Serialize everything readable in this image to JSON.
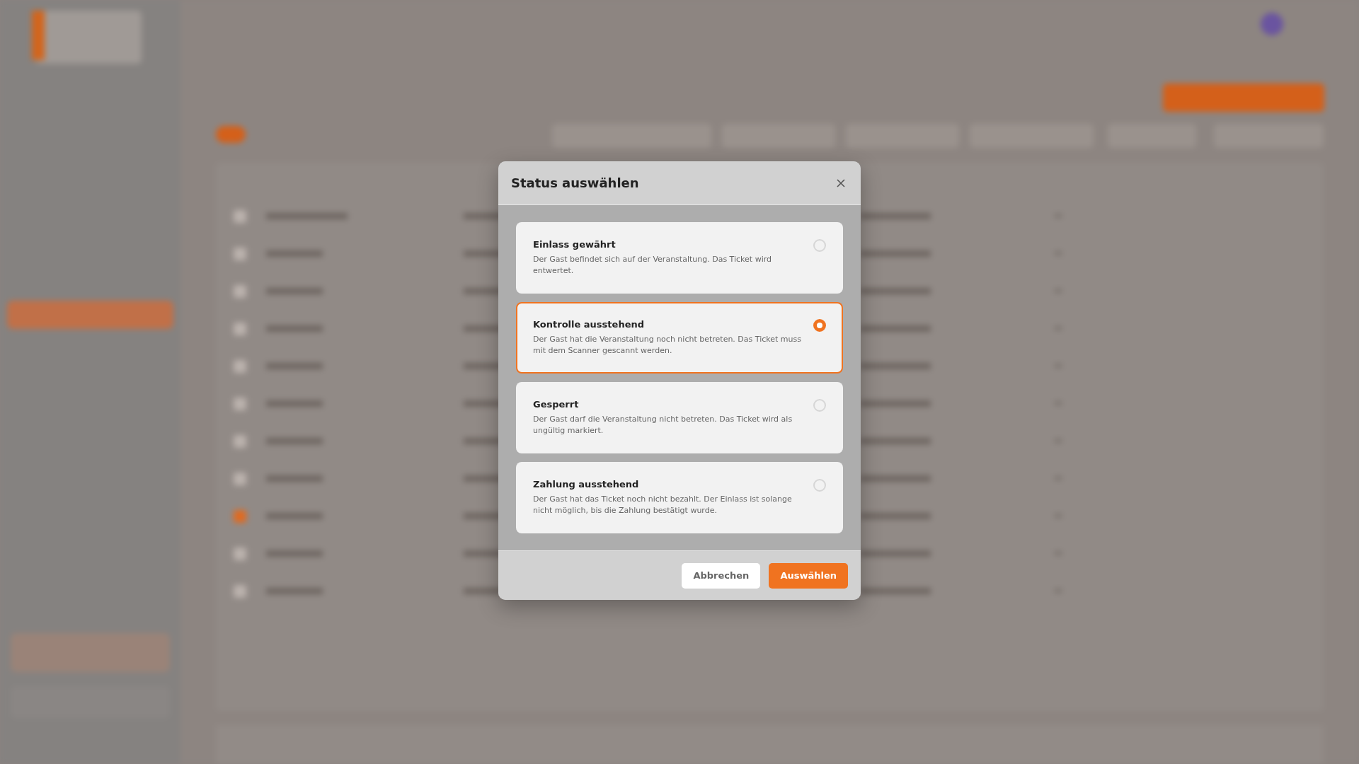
{
  "dialog": {
    "title": "Status auswählen",
    "options": [
      {
        "label": "Einlass gewährt",
        "description": "Der Gast befindet sich auf der Veranstaltung. Das Ticket wird entwertet.",
        "selected": false
      },
      {
        "label": "Kontrolle ausstehend",
        "description": "Der Gast hat die Veranstaltung noch nicht betreten. Das Ticket muss mit dem Scanner gescannt werden.",
        "selected": true
      },
      {
        "label": "Gesperrt",
        "description": "Der Gast darf die Veranstaltung nicht betreten. Das Ticket wird als ungültig markiert.",
        "selected": false
      },
      {
        "label": "Zahlung ausstehend",
        "description": "Der Gast hat das Ticket noch nicht bezahlt. Der Einlass ist solange nicht möglich, bis die Zahlung bestätigt wurde.",
        "selected": false
      }
    ],
    "buttons": [
      {
        "label": "Abbrechen",
        "kind": "secondary"
      },
      {
        "label": "Auswählen",
        "kind": "primary"
      }
    ]
  }
}
